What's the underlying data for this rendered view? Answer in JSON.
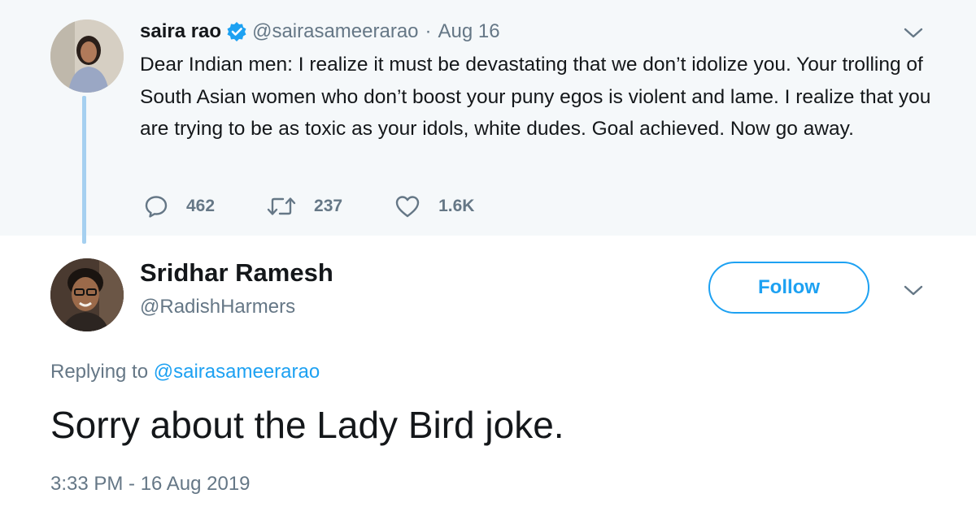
{
  "parent_tweet": {
    "name": "saira rao",
    "handle": "@sairasameerarao",
    "separator": "·",
    "date": "Aug 16",
    "text": "Dear Indian men: I realize it must be devastating that we don’t idolize you. Your trolling of South Asian women who don’t boost your puny egos is violent and lame. I realize that you are trying to be as toxic as your idols, white dudes. Goal achieved. Now go away.",
    "actions": {
      "replies": "462",
      "retweets": "237",
      "likes": "1.6K"
    },
    "icons": [
      "verified-badge-icon",
      "reply-icon",
      "retweet-icon",
      "like-icon",
      "chevron-down-icon"
    ]
  },
  "reply_tweet": {
    "name": "Sridhar Ramesh",
    "handle": "@RadishHarmers",
    "follow_label": "Follow",
    "replying_prefix": "Replying to",
    "replying_mention": "@sairasameerarao",
    "text": "Sorry about the Lady Bird joke.",
    "timestamp": "3:33 PM - 16 Aug 2019"
  },
  "colors": {
    "accent": "#1da1f2",
    "secondary_text": "#657786",
    "primary_text": "#14171a",
    "parent_background": "#f5f8fa",
    "thread_line": "#a5d0f0"
  }
}
